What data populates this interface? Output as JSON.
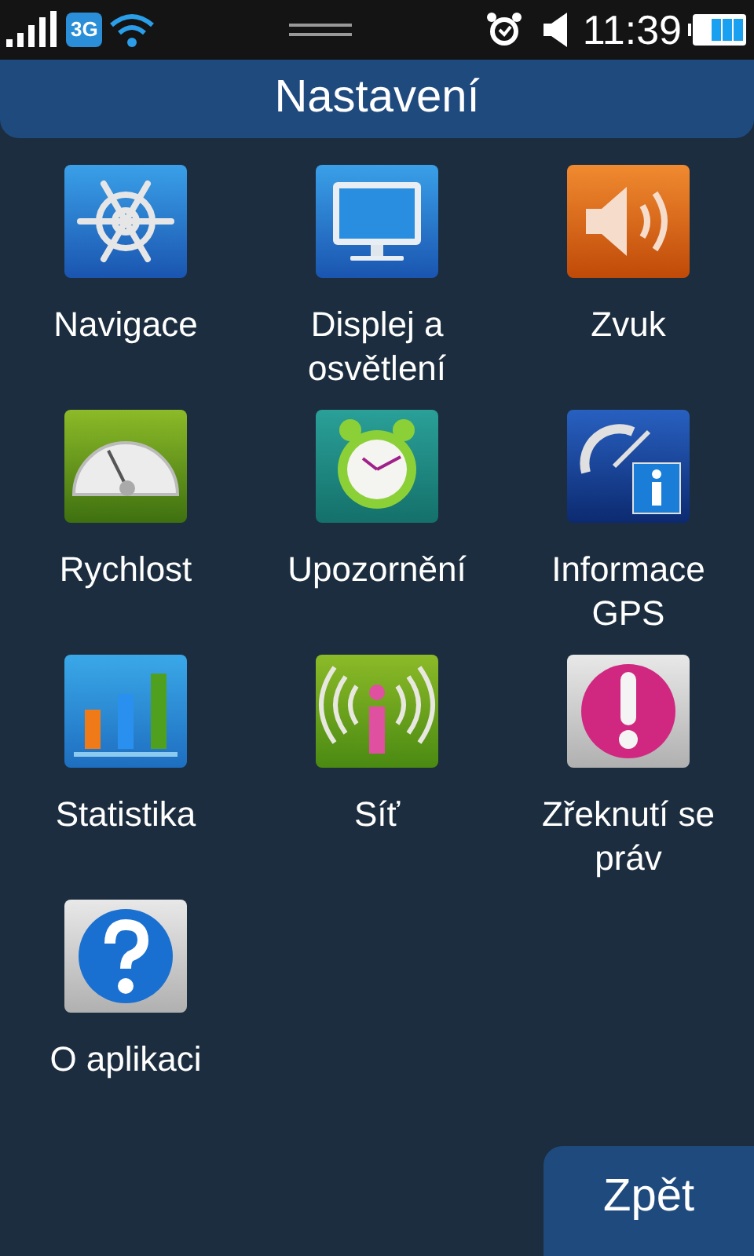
{
  "status_bar": {
    "network": "3G",
    "time": "11:39"
  },
  "title": "Nastavení",
  "items": [
    {
      "label": "Navigace",
      "kind": "wheel"
    },
    {
      "label": "Displej a osvětlení",
      "kind": "monitor"
    },
    {
      "label": "Zvuk",
      "kind": "speaker"
    },
    {
      "label": "Rychlost",
      "kind": "gauge"
    },
    {
      "label": "Upozornění",
      "kind": "alarm"
    },
    {
      "label": "Informace GPS",
      "kind": "satellite"
    },
    {
      "label": "Statistika",
      "kind": "chart"
    },
    {
      "label": "Síť",
      "kind": "signal"
    },
    {
      "label": "Zřeknutí se práv",
      "kind": "exclamation"
    },
    {
      "label": "O aplikaci",
      "kind": "question"
    }
  ],
  "back_button": "Zpět"
}
